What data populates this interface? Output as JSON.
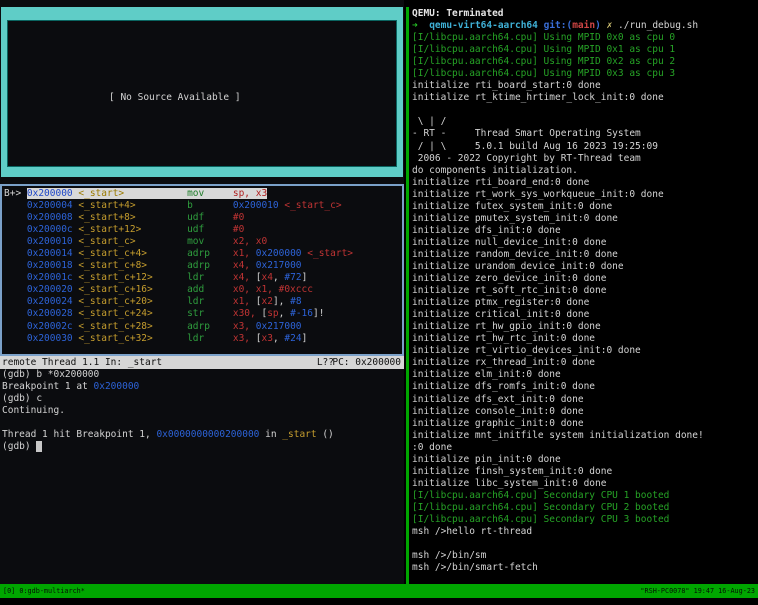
{
  "colors": {
    "source_border": "#5fcdc7",
    "asm_border": "#7ba1c9",
    "status_line_bg": "#d6d6d6",
    "tmux_green": "#00a600",
    "address_blue": "#2d63d8",
    "symbol_yellow": "#c59d2e",
    "mnemonic_green": "#2f9e3e",
    "register_red": "#c03434",
    "log_green": "#26a326"
  },
  "left_pane": {
    "source_window": {
      "message": "[ No Source Available ]"
    },
    "asm_window": {
      "rows": [
        {
          "marker": "B+> ",
          "current": true,
          "addr": "0x200000",
          "sym": "<_start>",
          "mn": "mov",
          "ops": [
            [
              "reg",
              "sp, x3"
            ]
          ]
        },
        {
          "marker": "    ",
          "current": false,
          "addr": "0x200004",
          "sym": "<_start+4>",
          "mn": "b",
          "ops": [
            [
              "imm",
              "0x200010"
            ],
            [
              "pun",
              " "
            ],
            [
              "reg",
              "<_start_c>"
            ]
          ]
        },
        {
          "marker": "    ",
          "current": false,
          "addr": "0x200008",
          "sym": "<_start+8>",
          "mn": "udf",
          "ops": [
            [
              "reg",
              "#0"
            ]
          ]
        },
        {
          "marker": "    ",
          "current": false,
          "addr": "0x20000c",
          "sym": "<_start+12>",
          "mn": "udf",
          "ops": [
            [
              "reg",
              "#0"
            ]
          ]
        },
        {
          "marker": "    ",
          "current": false,
          "addr": "0x200010",
          "sym": "<_start_c>",
          "mn": "mov",
          "ops": [
            [
              "reg",
              "x2, x0"
            ]
          ]
        },
        {
          "marker": "    ",
          "current": false,
          "addr": "0x200014",
          "sym": "<_start_c+4>",
          "mn": "adrp",
          "ops": [
            [
              "reg",
              "x1, "
            ],
            [
              "imm",
              "0x200000"
            ],
            [
              "pun",
              " "
            ],
            [
              "reg",
              "<_start>"
            ]
          ]
        },
        {
          "marker": "    ",
          "current": false,
          "addr": "0x200018",
          "sym": "<_start_c+8>",
          "mn": "adrp",
          "ops": [
            [
              "reg",
              "x4, "
            ],
            [
              "imm",
              "0x217000"
            ]
          ]
        },
        {
          "marker": "    ",
          "current": false,
          "addr": "0x20001c",
          "sym": "<_start_c+12>",
          "mn": "ldr",
          "ops": [
            [
              "reg",
              "x4, "
            ],
            [
              "pun",
              "["
            ],
            [
              "reg",
              "x4"
            ],
            [
              "pun",
              ", "
            ],
            [
              "imm",
              "#72"
            ],
            [
              "pun",
              "]"
            ]
          ]
        },
        {
          "marker": "    ",
          "current": false,
          "addr": "0x200020",
          "sym": "<_start_c+16>",
          "mn": "add",
          "ops": [
            [
              "reg",
              "x0, x1, #0xccc"
            ]
          ]
        },
        {
          "marker": "    ",
          "current": false,
          "addr": "0x200024",
          "sym": "<_start_c+20>",
          "mn": "ldr",
          "ops": [
            [
              "reg",
              "x1, "
            ],
            [
              "pun",
              "["
            ],
            [
              "reg",
              "x2"
            ],
            [
              "pun",
              "], "
            ],
            [
              "imm",
              "#8"
            ]
          ]
        },
        {
          "marker": "    ",
          "current": false,
          "addr": "0x200028",
          "sym": "<_start_c+24>",
          "mn": "str",
          "ops": [
            [
              "reg",
              "x30, "
            ],
            [
              "pun",
              "["
            ],
            [
              "reg",
              "sp"
            ],
            [
              "pun",
              ", "
            ],
            [
              "imm",
              "#-16"
            ],
            [
              "pun",
              "]!"
            ]
          ]
        },
        {
          "marker": "    ",
          "current": false,
          "addr": "0x20002c",
          "sym": "<_start_c+28>",
          "mn": "adrp",
          "ops": [
            [
              "reg",
              "x3, "
            ],
            [
              "imm",
              "0x217000"
            ]
          ]
        },
        {
          "marker": "    ",
          "current": false,
          "addr": "0x200030",
          "sym": "<_start_c+32>",
          "mn": "ldr",
          "ops": [
            [
              "reg",
              "x3, "
            ],
            [
              "pun",
              "["
            ],
            [
              "reg",
              "x3"
            ],
            [
              "pun",
              ", "
            ],
            [
              "imm",
              "#24"
            ],
            [
              "pun",
              "]"
            ]
          ]
        }
      ]
    },
    "status_line": {
      "left": "remote Thread 1.1 In: _start",
      "line": "L??",
      "pc": "PC: 0x200000"
    },
    "console_lines": [
      [
        [
          "w",
          "(gdb) b *0x200000"
        ]
      ],
      [
        [
          "w",
          "Breakpoint 1 at "
        ],
        [
          "addr",
          "0x200000"
        ]
      ],
      [
        [
          "w",
          "(gdb) c"
        ]
      ],
      [
        [
          "w",
          "Continuing."
        ]
      ],
      [],
      [
        [
          "w",
          "Thread 1 hit Breakpoint 1, "
        ],
        [
          "addr",
          "0x0000000000200000"
        ],
        [
          "w",
          " in "
        ],
        [
          "sym",
          "_start"
        ],
        [
          "w",
          " ()"
        ]
      ],
      [
        [
          "w",
          "(gdb) "
        ],
        [
          "cursor",
          " "
        ]
      ]
    ]
  },
  "right_pane": {
    "lines": [
      [
        [
          "wb",
          "QEMU: Terminated"
        ]
      ],
      [
        [
          "arrow",
          "➜"
        ],
        [
          "w",
          "  "
        ],
        [
          "dir",
          "qemu-virt64-aarch64"
        ],
        [
          "w",
          " "
        ],
        [
          "gitb",
          "git:("
        ],
        [
          "gitr",
          "main"
        ],
        [
          "gitb",
          ")"
        ],
        [
          "w",
          " "
        ],
        [
          "cross",
          "✗"
        ],
        [
          "w",
          " ./run_debug.sh"
        ]
      ],
      [
        [
          "green",
          "[I/libcpu.aarch64.cpu] Using MPID 0x0 as cpu 0"
        ]
      ],
      [
        [
          "green",
          "[I/libcpu.aarch64.cpu] Using MPID 0x1 as cpu 1"
        ]
      ],
      [
        [
          "green",
          "[I/libcpu.aarch64.cpu] Using MPID 0x2 as cpu 2"
        ]
      ],
      [
        [
          "green",
          "[I/libcpu.aarch64.cpu] Using MPID 0x3 as cpu 3"
        ]
      ],
      [
        [
          "w",
          "initialize rti_board_start:0 done"
        ]
      ],
      [
        [
          "w",
          "initialize rt_ktime_hrtimer_lock_init:0 done"
        ]
      ],
      [],
      [
        [
          "w",
          " \\ | /"
        ]
      ],
      [
        [
          "w",
          "- RT -     Thread Smart Operating System"
        ]
      ],
      [
        [
          "w",
          " / | \\     5.0.1 build Aug 16 2023 19:25:09"
        ]
      ],
      [
        [
          "w",
          " 2006 - 2022 Copyright by RT-Thread team"
        ]
      ],
      [
        [
          "w",
          "do components initialization."
        ]
      ],
      [
        [
          "w",
          "initialize rti_board_end:0 done"
        ]
      ],
      [
        [
          "w",
          "initialize rt_work_sys_workqueue_init:0 done"
        ]
      ],
      [
        [
          "w",
          "initialize futex_system_init:0 done"
        ]
      ],
      [
        [
          "w",
          "initialize pmutex_system_init:0 done"
        ]
      ],
      [
        [
          "w",
          "initialize dfs_init:0 done"
        ]
      ],
      [
        [
          "w",
          "initialize null_device_init:0 done"
        ]
      ],
      [
        [
          "w",
          "initialize random_device_init:0 done"
        ]
      ],
      [
        [
          "w",
          "initialize urandom_device_init:0 done"
        ]
      ],
      [
        [
          "w",
          "initialize zero_device_init:0 done"
        ]
      ],
      [
        [
          "w",
          "initialize rt_soft_rtc_init:0 done"
        ]
      ],
      [
        [
          "w",
          "initialize ptmx_register:0 done"
        ]
      ],
      [
        [
          "w",
          "initialize critical_init:0 done"
        ]
      ],
      [
        [
          "w",
          "initialize rt_hw_gpio_init:0 done"
        ]
      ],
      [
        [
          "w",
          "initialize rt_hw_rtc_init:0 done"
        ]
      ],
      [
        [
          "w",
          "initialize rt_virtio_devices_init:0 done"
        ]
      ],
      [
        [
          "w",
          "initialize rx_thread_init:0 done"
        ]
      ],
      [
        [
          "w",
          "initialize elm_init:0 done"
        ]
      ],
      [
        [
          "w",
          "initialize dfs_romfs_init:0 done"
        ]
      ],
      [
        [
          "w",
          "initialize dfs_ext_init:0 done"
        ]
      ],
      [
        [
          "w",
          "initialize console_init:0 done"
        ]
      ],
      [
        [
          "w",
          "initialize graphic_init:0 done"
        ]
      ],
      [
        [
          "w",
          "initialize mnt_initfile system initialization done!"
        ]
      ],
      [
        [
          "w",
          ":0 done"
        ]
      ],
      [
        [
          "w",
          "initialize pin_init:0 done"
        ]
      ],
      [
        [
          "w",
          "initialize finsh_system_init:0 done"
        ]
      ],
      [
        [
          "w",
          "initialize libc_system_init:0 done"
        ]
      ],
      [
        [
          "green",
          "[I/libcpu.aarch64.cpu] Secondary CPU 1 booted"
        ]
      ],
      [
        [
          "green",
          "[I/libcpu.aarch64.cpu] Secondary CPU 2 booted"
        ]
      ],
      [
        [
          "green",
          "[I/libcpu.aarch64.cpu] Secondary CPU 3 booted"
        ]
      ],
      [
        [
          "w",
          "msh />hello rt-thread"
        ]
      ],
      [],
      [
        [
          "w",
          "msh />/bin/sm"
        ]
      ],
      [
        [
          "w",
          "msh />/bin/smart-fetch"
        ]
      ],
      []
    ]
  },
  "tmux_bar": {
    "left": "[0] 0:gdb-multiarch*",
    "right": "\"RSH-PC0078\" 19:47 16-Aug-23"
  }
}
